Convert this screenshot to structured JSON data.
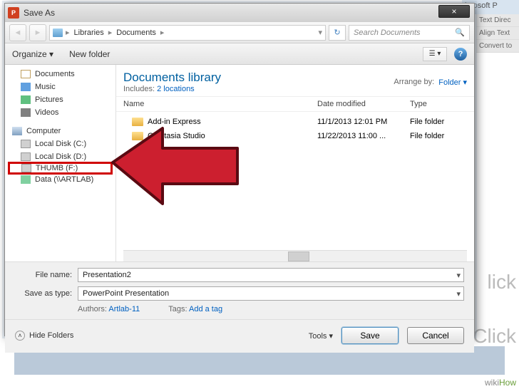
{
  "titlebar": {
    "title": "Save As",
    "close": "×"
  },
  "bg": {
    "app": "icrosoft P",
    "side": [
      "Text Direc",
      "Align Text",
      "Convert to"
    ],
    "click1": "lick",
    "click2": "Click"
  },
  "nav": {
    "crumb": [
      "Libraries",
      "Documents"
    ],
    "search_placeholder": "Search Documents"
  },
  "toolbar": {
    "organize": "Organize ▾",
    "newfolder": "New folder",
    "help": "?"
  },
  "tree": {
    "docs": "Documents",
    "music": "Music",
    "pics": "Pictures",
    "vids": "Videos",
    "computer": "Computer",
    "c": "Local Disk (C:)",
    "d": "Local Disk (D:)",
    "thumb": "THUMB (F:)",
    "data": "Data (\\\\ARTLAB)"
  },
  "lib": {
    "title": "Documents library",
    "includes_pre": "Includes: ",
    "includes_link": "2 locations",
    "arrange_lbl": "Arrange by:",
    "arrange_val": "Folder ▾"
  },
  "cols": {
    "name": "Name",
    "date": "Date modified",
    "type": "Type"
  },
  "files": [
    {
      "name": "Add-in Express",
      "date": "11/1/2013 12:01 PM",
      "type": "File folder"
    },
    {
      "name": "Camtasia Studio",
      "date": "11/22/2013 11:00 ...",
      "type": "File folder"
    }
  ],
  "fields": {
    "name_lbl": "File name:",
    "name_val": "Presentation2",
    "type_lbl": "Save as type:",
    "type_val": "PowerPoint Presentation",
    "authors_lbl": "Authors:",
    "authors_val": "Artlab-11",
    "tags_lbl": "Tags:",
    "tags_val": "Add a tag"
  },
  "footer": {
    "hide": "Hide Folders",
    "tools": "Tools ▾",
    "save": "Save",
    "cancel": "Cancel"
  },
  "watermark": {
    "wiki": "wiki",
    "how": "How"
  }
}
